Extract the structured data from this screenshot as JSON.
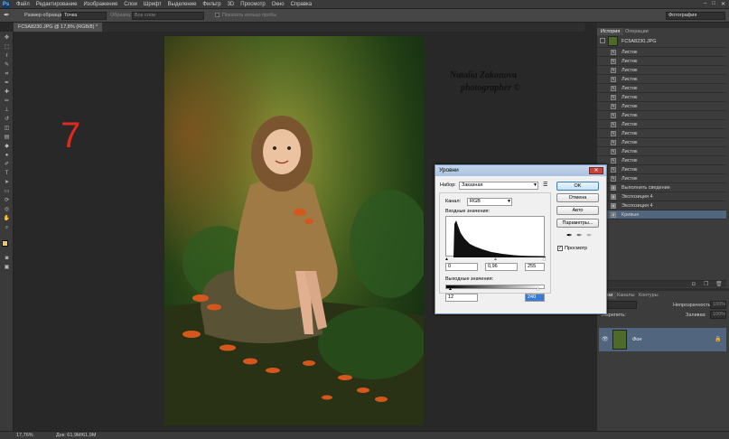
{
  "app": {
    "logo": "Ps"
  },
  "menu": [
    "Файл",
    "Редактирование",
    "Изображение",
    "Слои",
    "Шрифт",
    "Выделение",
    "Фильтр",
    "3D",
    "Просмотр",
    "Окно",
    "Справка"
  ],
  "options": {
    "size_label": "Размер образца:",
    "size_value": "Точка",
    "sample_label": "Образец:",
    "sample_value": "Все слои",
    "ring_label": "Показать кольцо пробы",
    "workspace": "Фотография"
  },
  "document_tab": "FC5A8230.JPG @ 17,8% (RGB/8) *",
  "overlay": {
    "step_number": "7",
    "signature_line1": "Natalia Zakonova",
    "signature_line2": "photographer ©"
  },
  "status": {
    "zoom": "17,76%",
    "doc": "Док: 61,9M/61,9M"
  },
  "history": {
    "tabs": [
      "История",
      "Операции"
    ],
    "snapshot": "FC5A8230.JPG",
    "items": [
      "Листик",
      "Листик",
      "Листик",
      "Листик",
      "Листик",
      "Листик",
      "Листик",
      "Листик",
      "Листик",
      "Листик",
      "Листик",
      "Листик",
      "Листик",
      "Листик",
      "Листик",
      "Выполнить сведение",
      "Экспозиция 4",
      "Экспозиция 4",
      "Кривые"
    ]
  },
  "layers": {
    "tabs": [
      "Слои",
      "Каналы",
      "Контуры"
    ],
    "opacity_label": "Непрозрачность:",
    "opacity_value": "100%",
    "lock_label": "Закрепить:",
    "fill_label": "Заливка:",
    "fill_value": "100%",
    "layer_name": "Фон"
  },
  "dialog": {
    "title": "Уровни",
    "preset_label": "Набор:",
    "preset_value": "Заказная",
    "channel_label": "Канал:",
    "channel_value": "RGB",
    "input_label": "Входные значения:",
    "input_black": "0",
    "input_gamma": "0,96",
    "input_white": "255",
    "output_label": "Выходные значения:",
    "output_black": "12",
    "output_white": "240",
    "ok": "OK",
    "cancel": "Отмена",
    "auto": "Авто",
    "params": "Параметры...",
    "preview": "Просмотр"
  },
  "colors": {
    "accent": "#51657e",
    "step_number": "#e0281e"
  }
}
